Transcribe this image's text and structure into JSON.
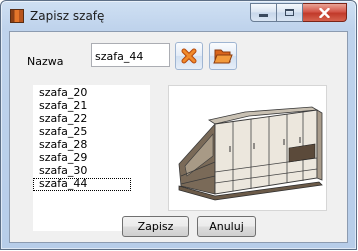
{
  "window": {
    "title": "Zapisz szafę",
    "app_icon": "wardrobe-app-icon",
    "caption_buttons": [
      "minimize-icon",
      "maximize-icon",
      "close-icon"
    ]
  },
  "form": {
    "name_label": "Nazwa",
    "name_value": "szafa_44",
    "delete_button_icon": "delete-x-icon",
    "load_button_icon": "load-folder-icon"
  },
  "list": {
    "items": [
      "szafa_20",
      "szafa_21",
      "szafa_22",
      "szafa_25",
      "szafa_28",
      "szafa_29",
      "szafa_30",
      "szafa_44"
    ],
    "selected": "szafa_44"
  },
  "preview": {
    "image": "wardrobe-3d-preview"
  },
  "buttons": {
    "save_label": "Zapisz",
    "cancel_label": "Anuluj"
  },
  "colors": {
    "delete_icon": "#e8741e",
    "load_icon": "#e8741e",
    "close_button": "#c7402f"
  }
}
